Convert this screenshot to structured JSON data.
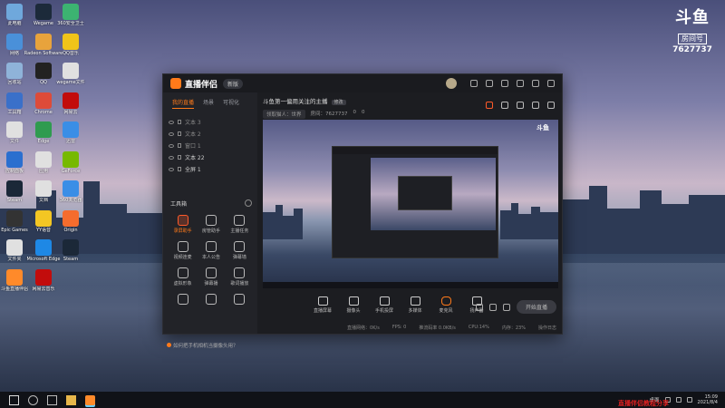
{
  "desktop": {
    "icons": [
      {
        "label": "此电脑",
        "color": "#6fa8dc"
      },
      {
        "label": "Wegame",
        "color": "#1c2a3a"
      },
      {
        "label": "360安全卫士",
        "color": "#3cb371"
      },
      {
        "label": "网络",
        "color": "#4a90d9"
      },
      {
        "label": "Radeon Software",
        "color": "#e8a33c"
      },
      {
        "label": "QQ音乐",
        "color": "#f0c419"
      },
      {
        "label": "回收站",
        "color": "#8fb3d9"
      },
      {
        "label": "QQ",
        "color": "#222"
      },
      {
        "label": "wegame文件",
        "color": "#e0e0e0"
      },
      {
        "label": "工具箱",
        "color": "#3a70c9"
      },
      {
        "label": "Chrome",
        "color": "#dd4b39"
      },
      {
        "label": "网易云",
        "color": "#c20c0c"
      },
      {
        "label": "文件",
        "color": "#e0e0e0"
      },
      {
        "label": "Edge",
        "color": "#2f9b4f"
      },
      {
        "label": "迅雷",
        "color": "#3a8ee6"
      },
      {
        "label": "控制面板",
        "color": "#2b6fcf"
      },
      {
        "label": "应用",
        "color": "#e0e0e0"
      },
      {
        "label": "GeForce",
        "color": "#76b900"
      },
      {
        "label": "Steam",
        "color": "#1b2838"
      },
      {
        "label": "文档",
        "color": "#e0e0e0"
      },
      {
        "label": "360浏览器",
        "color": "#3a8ee6"
      },
      {
        "label": "Epic Games",
        "color": "#333"
      },
      {
        "label": "YY语音",
        "color": "#f3c623"
      },
      {
        "label": "Origin",
        "color": "#f56c2d"
      },
      {
        "label": "文件夹",
        "color": "#e0e0e0"
      },
      {
        "label": "Microsoft Edge",
        "color": "#1e88e5"
      },
      {
        "label": "Steam",
        "color": "#1b2838"
      },
      {
        "label": "斗鱼直播伴侣",
        "color": "#ff8a2a"
      },
      {
        "label": "网易云音乐",
        "color": "#c20c0c"
      }
    ]
  },
  "douyu_logo": {
    "mark": "斗鱼",
    "room_label": "房间号",
    "room_id": "7627737"
  },
  "app": {
    "name": "直播伴侣",
    "version_badge": "新版",
    "tabs": [
      "我的直播",
      "场景",
      "可视化"
    ],
    "scenes": [
      "文本 3",
      "文本 2",
      "窗口 1",
      "文本 22",
      "全屏 1"
    ],
    "tools_title": "工具箱",
    "tools": [
      {
        "label": "录屏助手",
        "hot": true
      },
      {
        "label": "房管助手",
        "hot": false
      },
      {
        "label": "主播任务",
        "hot": false
      },
      {
        "label": "视频连麦",
        "hot": false
      },
      {
        "label": "本人公告",
        "hot": false
      },
      {
        "label": "弹幕墙",
        "hot": false
      },
      {
        "label": "虚拟形象",
        "hot": false
      },
      {
        "label": "弹幕播",
        "hot": false
      },
      {
        "label": "歌词播放",
        "hot": false
      },
      {
        "label": "",
        "hot": false
      },
      {
        "label": "",
        "hot": false
      },
      {
        "label": "",
        "hot": false
      }
    ],
    "tip": "如何把手机相机当摄像头用？",
    "room": {
      "title": "斗鱼第一偏用关注的主播",
      "edit_label": "修改",
      "category": "领取猫人：世界",
      "room_id": "房间：7627737",
      "likes": "0",
      "fans": "0"
    },
    "controls": [
      {
        "label": "直播屏幕",
        "icon": "screen-icon"
      },
      {
        "label": "摄像头",
        "icon": "camera-icon"
      },
      {
        "label": "手机投屏",
        "icon": "phone-icon"
      },
      {
        "label": "多媒体",
        "icon": "media-icon"
      },
      {
        "label": "麦克风",
        "icon": "mic-icon"
      },
      {
        "label": "扬声器",
        "icon": "speaker-icon"
      }
    ],
    "start_label": "开始直播",
    "status": [
      "直播网络：0K/s",
      "FPS: 0",
      "推流码率 0.0KB/s",
      "CPU:14%",
      "内存：23%",
      "操作日志"
    ]
  },
  "taskbar": {
    "tray_text": "桌面",
    "time": "15:09",
    "date": "2021/8/4"
  },
  "watermark": "直播伴侣教程分享"
}
